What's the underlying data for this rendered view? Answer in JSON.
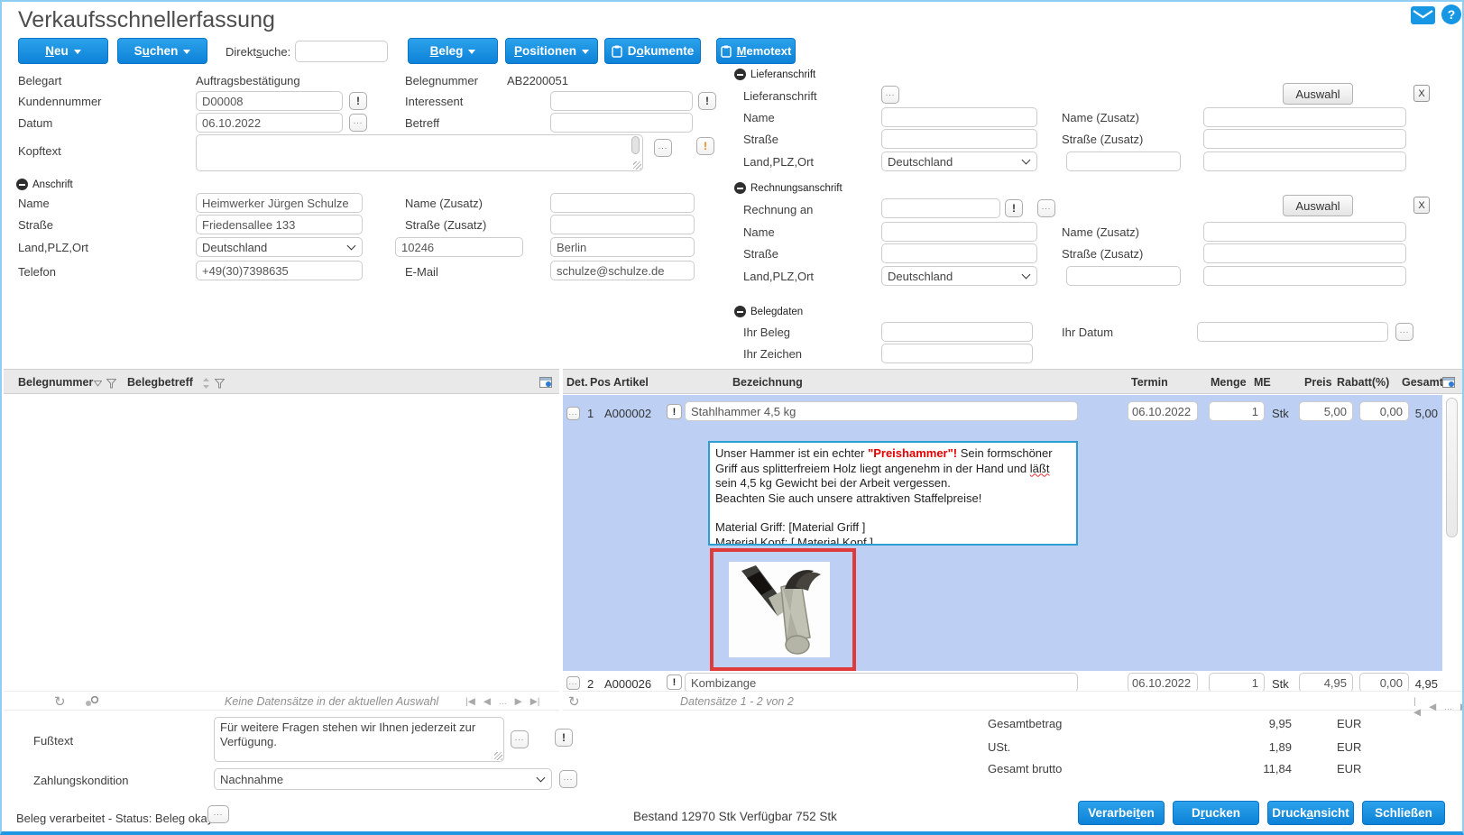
{
  "window": {
    "title": "Verkaufsschnellerfassung"
  },
  "symbols": {
    "ellipsis": "...",
    "exclamation": "!",
    "question": "?",
    "refresh": "↻",
    "pager_first": "|◀",
    "pager_prev": "◀",
    "pager_gap": "...",
    "pager_next": "▶",
    "pager_last": "▶|"
  },
  "toolbar": {
    "neu": {
      "pre": "",
      "key": "N",
      "post": "eu"
    },
    "suchen": {
      "pre": "S",
      "key": "u",
      "post": "chen"
    },
    "direktsuche": {
      "label": {
        "pre": "Direkt",
        "key": "s",
        "post": "uche:"
      },
      "value": ""
    },
    "beleg": {
      "pre": "",
      "key": "B",
      "post": "eleg"
    },
    "positionen": {
      "pre": "",
      "key": "P",
      "post": "ositionen"
    },
    "dokumente": {
      "pre": "D",
      "key": "o",
      "post": "kumente"
    },
    "memotext": {
      "pre": "",
      "key": "M",
      "post": "emotext"
    }
  },
  "head": {
    "belegart_label": "Belegart",
    "belegart_value": "Auftragsbestätigung",
    "kundennummer_label": "Kundennummer",
    "kundennummer_value": "D00008",
    "datum_label": "Datum",
    "datum_value": "06.10.2022",
    "kopftext_label": "Kopftext",
    "kopftext_value": "",
    "belegnummer_label": "Belegnummer",
    "belegnummer_value": "AB2200051",
    "interessent_label": "Interessent",
    "interessent_value": "",
    "betreff_label": "Betreff",
    "betreff_value": ""
  },
  "anschrift": {
    "section": "Anschrift",
    "name_label": "Name",
    "name_value": "Heimwerker Jürgen Schulze",
    "name2_label": "Name (Zusatz)",
    "name2_value": "",
    "strasse_label": "Straße",
    "strasse_value": "Friedensallee 133",
    "strasse2_label": "Straße (Zusatz)",
    "strasse2_value": "",
    "land_label": "Land,PLZ,Ort",
    "land_value": "Deutschland",
    "plz_value": "10246",
    "ort_value": "Berlin",
    "telefon_label": "Telefon",
    "telefon_value": "+49(30)7398635",
    "email_label": "E-Mail",
    "email_value": "schulze@schulze.de"
  },
  "liefer": {
    "section": "Lieferanschrift",
    "row_label": "Lieferanschrift",
    "auswahl": "Auswahl",
    "clear": "X",
    "name_label": "Name",
    "name_value": "",
    "name2_label": "Name (Zusatz)",
    "name2_value": "",
    "strasse_label": "Straße",
    "strasse_value": "",
    "strasse2_label": "Straße (Zusatz)",
    "strasse2_value": "",
    "land_label": "Land,PLZ,Ort",
    "land_value": "Deutschland",
    "plz_value": "",
    "ort_value": ""
  },
  "rechnung": {
    "section": "Rechnungsanschrift",
    "row_label": "Rechnung an",
    "row_value": "",
    "auswahl": "Auswahl",
    "clear": "X",
    "name_label": "Name",
    "name_value": "",
    "name2_label": "Name (Zusatz)",
    "name2_value": "",
    "strasse_label": "Straße",
    "strasse_value": "",
    "strasse2_label": "Straße (Zusatz)",
    "strasse2_value": "",
    "land_label": "Land,PLZ,Ort",
    "land_value": "Deutschland",
    "plz_value": "",
    "ort_value": ""
  },
  "belegdaten": {
    "section": "Belegdaten",
    "ihr_beleg_label": "Ihr Beleg",
    "ihr_beleg_value": "",
    "ihr_datum_label": "Ihr Datum",
    "ihr_datum_value": "",
    "ihr_zeichen_label": "Ihr Zeichen",
    "ihr_zeichen_value": ""
  },
  "left_table": {
    "col_belegnummer": "Belegnummer",
    "col_belegbetreff": "Belegbetreff",
    "empty_text": "Keine Datensätze in der aktuellen Auswahl"
  },
  "positions": {
    "headers": {
      "det": "Det.",
      "pos": "Pos",
      "artikel": "Artikel",
      "bezeichnung": "Bezeichnung",
      "termin": "Termin",
      "menge": "Menge",
      "me": "ME",
      "preis": "Preis",
      "rabatt": "Rabatt(%)",
      "gesamt": "Gesamt"
    },
    "rows": [
      {
        "pos": "1",
        "artikel": "A000002",
        "bezeichnung": "Stahlhammer 4,5 kg",
        "termin": "06.10.2022",
        "menge": "1",
        "me": "Stk",
        "preis": "5,00",
        "rabatt": "0,00",
        "gesamt": "5,00"
      },
      {
        "pos": "2",
        "artikel": "A000026",
        "bezeichnung": "Kombizange",
        "termin": "06.10.2022",
        "menge": "1",
        "me": "Stk",
        "preis": "4,95",
        "rabatt": "0,00",
        "gesamt": "4,95"
      }
    ],
    "memo": {
      "p1_pre": "Unser Hammer ist ein echter ",
      "p1_highlight": "\"Preishammer\"!",
      "p1_mid": " Sein formschöner Griff aus splitterfreiem Holz liegt angenehm in der Hand und ",
      "p1_spell": "läßt",
      "p1_post": " sein 4,5 kg Gewicht bei der Arbeit vergessen.",
      "p2": "Beachten Sie auch unsere attraktiven Staffelpreise!",
      "p3": "Material Griff: [Material Griff ]",
      "p4": "Material Kopf: [ Material Kopf ]"
    },
    "status_text": "Datensätze 1 - 2 von 2"
  },
  "footer": {
    "fusstext_label": "Fußtext",
    "fusstext_value": "Für weitere Fragen stehen wir Ihnen jederzeit zur Verfügung.",
    "zahlung_label": "Zahlungskondition",
    "zahlung_value": "Nachnahme",
    "status_text": "Beleg verarbeitet - Status: Beleg okay",
    "bestand_text": "Bestand 12970 Stk Verfügbar 752 Stk",
    "totals": [
      {
        "label": "Gesamtbetrag",
        "value": "9,95",
        "currency": "EUR"
      },
      {
        "label": "USt.",
        "value": "1,89",
        "currency": "EUR"
      },
      {
        "label": "Gesamt brutto",
        "value": "11,84",
        "currency": "EUR"
      }
    ],
    "buttons": {
      "verarbeiten": {
        "pre": "Verarbei",
        "key": "t",
        "post": "en"
      },
      "drucken": {
        "pre": "D",
        "key": "r",
        "post": "ucken"
      },
      "druckansicht": {
        "pre": "Druck",
        "key": "a",
        "post": "nsicht"
      },
      "schliessen": {
        "pre": "Schließen",
        "key": "",
        "post": ""
      }
    }
  },
  "colors": {
    "accent_blue": "#1b8fe0",
    "selection_blue": "#bdd0f3",
    "memo_border": "#2b9ed2",
    "highlight_red": "#e30000",
    "image_frame_red": "#e03b3b"
  }
}
